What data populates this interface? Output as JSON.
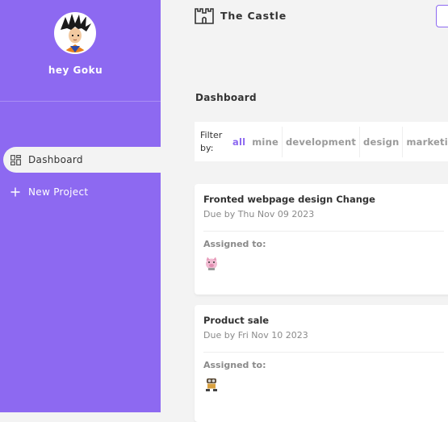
{
  "sidebar": {
    "greeting": "hey Goku",
    "avatar_icon": "goku-avatar-icon",
    "items": [
      {
        "label": "Dashboard",
        "icon": "dashboard-icon",
        "active": true
      },
      {
        "label": "New Project",
        "icon": "plus-icon",
        "active": false
      }
    ]
  },
  "header": {
    "brand": "The Castle",
    "brand_icon": "castle-icon"
  },
  "main": {
    "title": "Dashboard",
    "filter": {
      "label": "Filter by:",
      "options": [
        "all",
        "mine",
        "development",
        "design",
        "marketing"
      ],
      "active": "all"
    },
    "projects": [
      {
        "title": "Fronted webpage design Change",
        "due": "Due by Thu Nov 09 2023",
        "assigned_label": "Assigned to:",
        "assignee_icon": "pig-avatar-icon"
      },
      {
        "title": "Product sale",
        "due": "Due by Fri Nov 10 2023",
        "assigned_label": "Assigned to:",
        "assignee_icon": "robot-avatar-icon"
      }
    ]
  },
  "colors": {
    "accent": "#8d69f1",
    "background": "#f3f3f3"
  }
}
